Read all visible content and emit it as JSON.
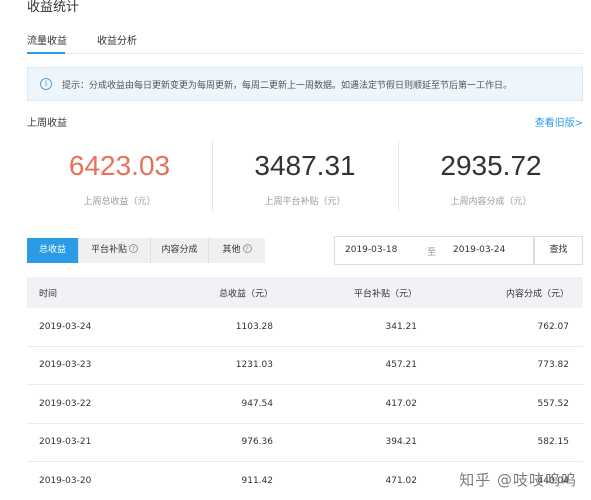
{
  "page": {
    "title": "收益统计"
  },
  "tabs": [
    {
      "label": "流量收益",
      "active": true
    },
    {
      "label": "收益分析",
      "active": false
    }
  ],
  "notice": {
    "text": "提示：分成收益由每日更新变更为每周更新，每周二更新上一周数据。如遇法定节假日则顺延至节后第一工作日。"
  },
  "weekly": {
    "title": "上周收益",
    "old_version_link": "查看旧版>",
    "stats": [
      {
        "value": "6423.03",
        "label": "上周总收益（元）"
      },
      {
        "value": "3487.31",
        "label": "上周平台补贴（元）"
      },
      {
        "value": "2935.72",
        "label": "上周内容分成（元）"
      }
    ]
  },
  "filters": {
    "tabs": [
      {
        "label": "总收益",
        "active": true
      },
      {
        "label": "平台补贴",
        "active": false
      },
      {
        "label": "内容分成",
        "active": false
      },
      {
        "label": "其他",
        "active": false
      }
    ],
    "start_date": "2019-03-18",
    "separator": "至",
    "end_date": "2019-03-24",
    "search_label": "查找"
  },
  "table": {
    "headers": [
      "时间",
      "总收益（元）",
      "平台补贴（元）",
      "内容分成（元）"
    ],
    "rows": [
      [
        "2019-03-24",
        "1103.28",
        "341.21",
        "762.07"
      ],
      [
        "2019-03-23",
        "1231.03",
        "457.21",
        "773.82"
      ],
      [
        "2019-03-22",
        "947.54",
        "417.02",
        "557.52"
      ],
      [
        "2019-03-21",
        "976.36",
        "394.21",
        "582.15"
      ],
      [
        "2019-03-20",
        "911.42",
        "471.02",
        "440.04"
      ]
    ]
  },
  "watermark": "知乎 @吱吱呜呜"
}
